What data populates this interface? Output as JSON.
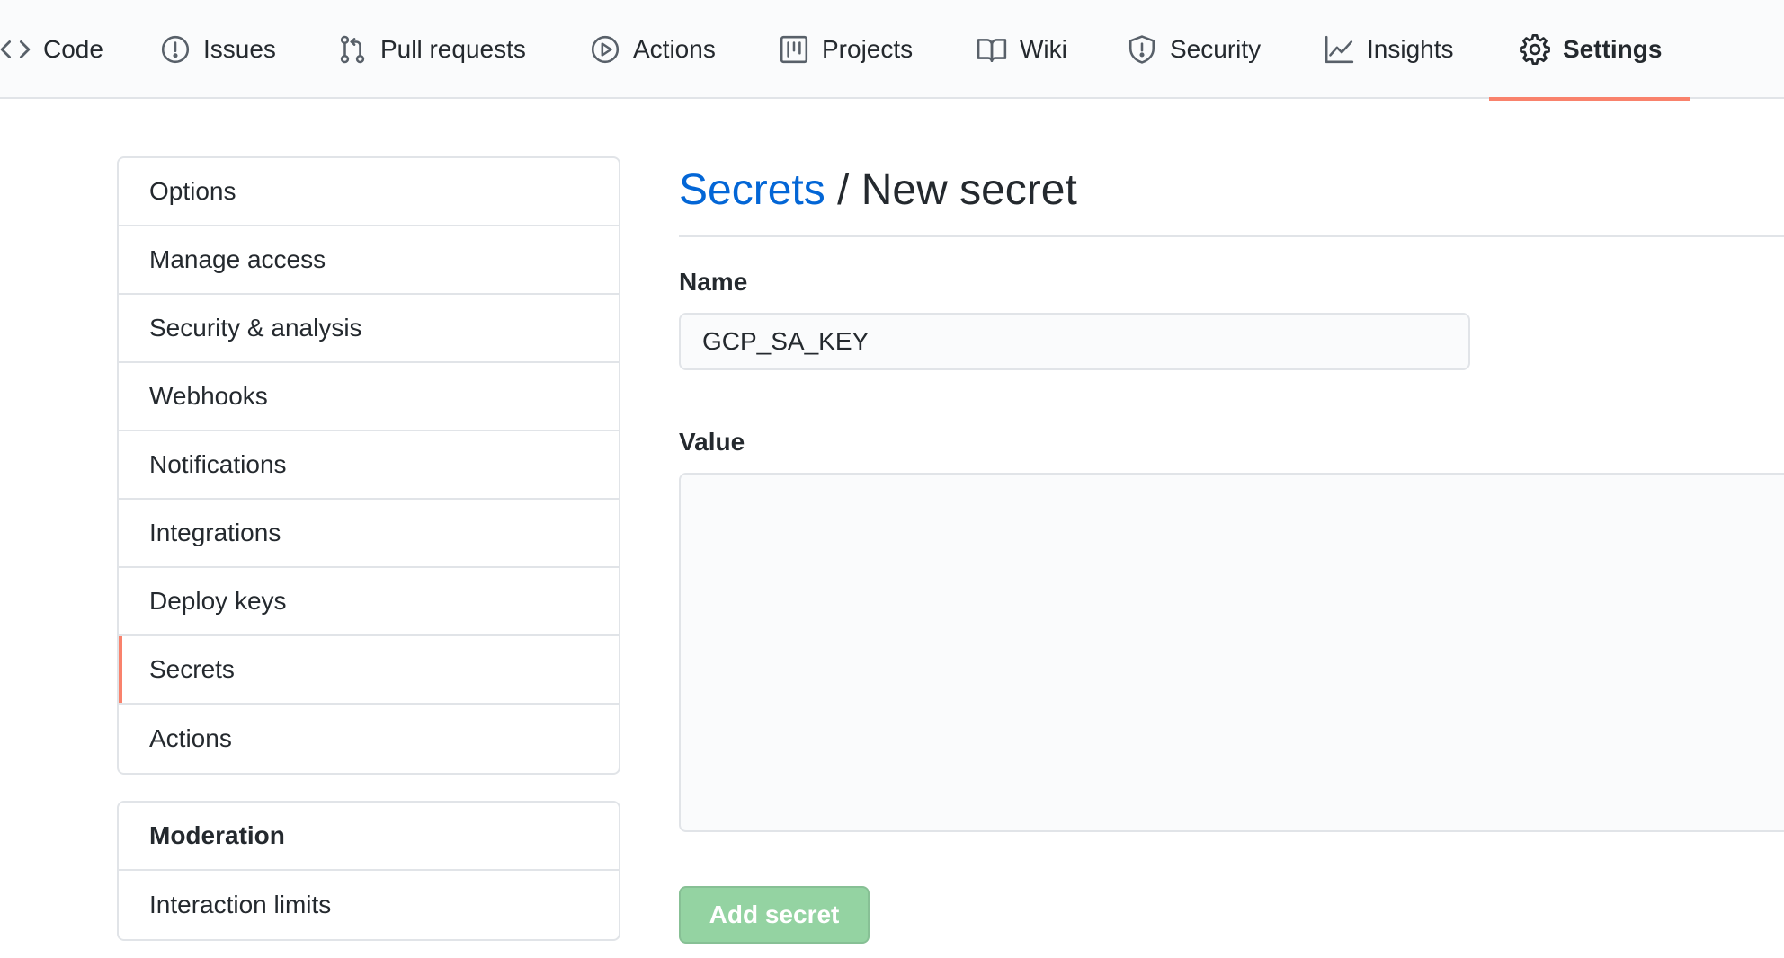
{
  "repo_nav": {
    "tabs": [
      {
        "label": "Code",
        "icon": "code-icon"
      },
      {
        "label": "Issues",
        "icon": "issue-opened-icon"
      },
      {
        "label": "Pull requests",
        "icon": "git-pull-request-icon"
      },
      {
        "label": "Actions",
        "icon": "play-icon"
      },
      {
        "label": "Projects",
        "icon": "project-icon"
      },
      {
        "label": "Wiki",
        "icon": "book-icon"
      },
      {
        "label": "Security",
        "icon": "shield-icon"
      },
      {
        "label": "Insights",
        "icon": "graph-icon"
      },
      {
        "label": "Settings",
        "icon": "gear-icon"
      }
    ],
    "selected": "Settings"
  },
  "sidebar": {
    "items": [
      {
        "label": "Options"
      },
      {
        "label": "Manage access"
      },
      {
        "label": "Security & analysis"
      },
      {
        "label": "Webhooks"
      },
      {
        "label": "Notifications"
      },
      {
        "label": "Integrations"
      },
      {
        "label": "Deploy keys"
      },
      {
        "label": "Secrets"
      },
      {
        "label": "Actions"
      }
    ],
    "selected": "Secrets",
    "moderation": {
      "heading": "Moderation",
      "items": [
        {
          "label": "Interaction limits"
        }
      ]
    }
  },
  "main": {
    "breadcrumb": {
      "parent": "Secrets",
      "separator": "/",
      "current": "New secret"
    },
    "name_field": {
      "label": "Name",
      "value": "GCP_SA_KEY"
    },
    "value_field": {
      "label": "Value",
      "value": ""
    },
    "submit_label": "Add secret"
  },
  "colors": {
    "accent_underline": "#f9826c",
    "link_blue": "#0366d6",
    "button_disabled_green": "#94d3a2",
    "border": "#e1e4e8",
    "nav_background": "#fafbfc",
    "text": "#24292e"
  }
}
